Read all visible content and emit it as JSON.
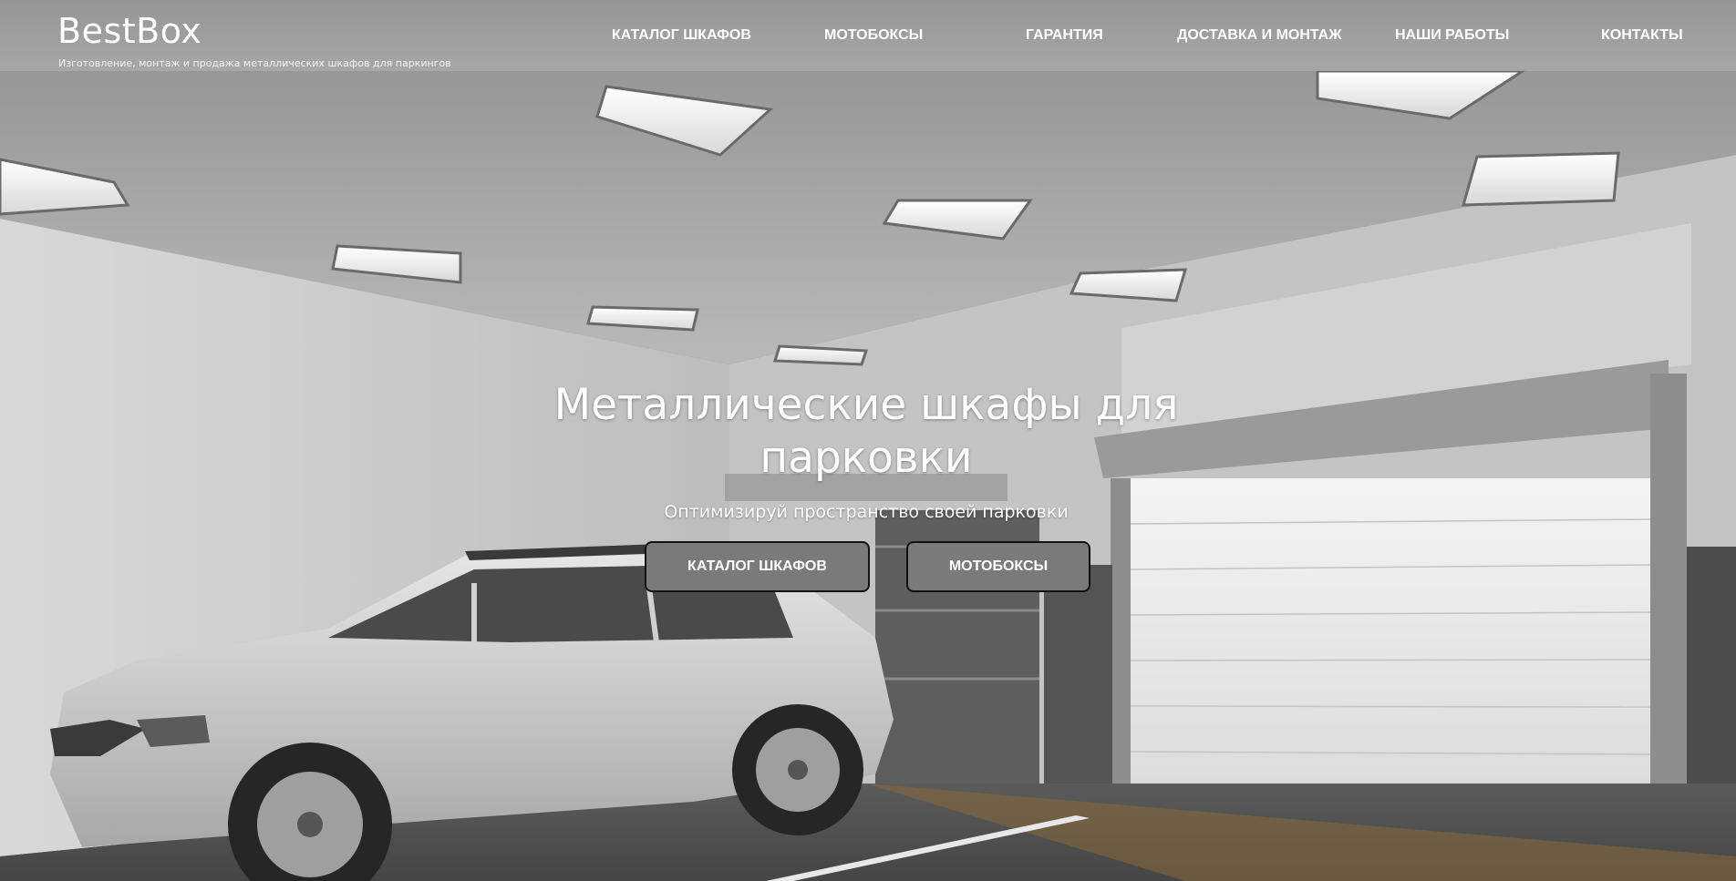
{
  "header": {
    "logo": "BestBox",
    "tagline": "Изготовление, монтаж и продажа металлических шкафов для паркингов"
  },
  "nav": {
    "items": [
      {
        "label": "КАТАЛОГ ШКАФОВ"
      },
      {
        "label": "МОТОБОКСЫ"
      },
      {
        "label": "ГАРАНТИЯ"
      },
      {
        "label": "ДОСТАВКА И МОНТАЖ"
      },
      {
        "label": "НАШИ РАБОТЫ"
      },
      {
        "label": "КОНТАКТЫ"
      }
    ]
  },
  "hero": {
    "title_line1": "Металлические шкафы для",
    "title_line2": "парковки",
    "subtitle": "Оптимизируй пространство своей парковки",
    "buttons": [
      {
        "label": "КАТАЛОГ ШКАФОВ"
      },
      {
        "label": "МОТОБОКСЫ"
      }
    ]
  },
  "colors": {
    "button_bg": "#7a7a7a",
    "button_border": "#111111",
    "text": "#ffffff"
  }
}
